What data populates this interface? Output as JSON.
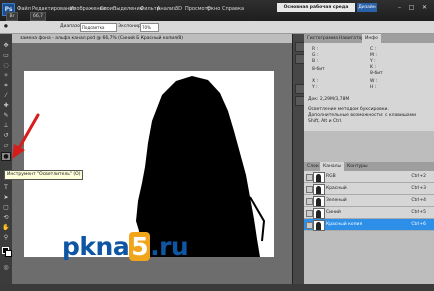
{
  "menubar": {
    "logo": "Ps",
    "items": [
      "Файл",
      "Редактирование",
      "Изображение",
      "Слои",
      "Выделение",
      "Фильтр",
      "Анализ",
      "3D",
      "Просмотр",
      "Окно",
      "Справка"
    ],
    "zoom": "66,7",
    "workspace": "Основная рабочая среда",
    "design_label": "Дизайн"
  },
  "options": {
    "range_label": "Диапазон:",
    "range_value": "Подсветка",
    "exposure_label": "Экспонир.:",
    "exposure_value": "70%"
  },
  "document": {
    "tab_title": "замена фона - альфа канал.psd @ 66,7% (Синий Б Красный копия/8)"
  },
  "tooltip": "Инструмент \"Осветлитель\" (O)",
  "watermark": {
    "pre": "pkna",
    "five": "5",
    "post": ".ru"
  },
  "panel_tabs": [
    "Гистограмма",
    "Навигатор",
    "Инфо"
  ],
  "info": {
    "r": "R :",
    "g": "G :",
    "b": "B :",
    "c": "C :",
    "m": "M :",
    "y": "Y :",
    "k": "K :",
    "bit1": "8-бит",
    "bit2": "8-бит",
    "x": "X :",
    "y_pos": "Y :",
    "w": "W :",
    "h": "H :",
    "doc": "Док: 2,29M/3,78M",
    "hint": "Осветление методом буксировки. Дополнительные возможности: с клавишами Shift, Alt и Ctrl."
  },
  "channels_tabs": [
    "Слои",
    "Каналы",
    "Контуры"
  ],
  "channels": [
    {
      "name": "RGB",
      "shortcut": "Ctrl+2",
      "selected": false
    },
    {
      "name": "Красный",
      "shortcut": "Ctrl+3",
      "selected": false
    },
    {
      "name": "Зеленый",
      "shortcut": "Ctrl+4",
      "selected": false
    },
    {
      "name": "Синий",
      "shortcut": "Ctrl+5",
      "selected": false
    },
    {
      "name": "Красный копия",
      "shortcut": "Ctrl+6",
      "selected": true
    }
  ],
  "colors": {
    "accent": "#2d8fe8",
    "arrow": "#d71c1c",
    "brand": "#0e56a4"
  }
}
